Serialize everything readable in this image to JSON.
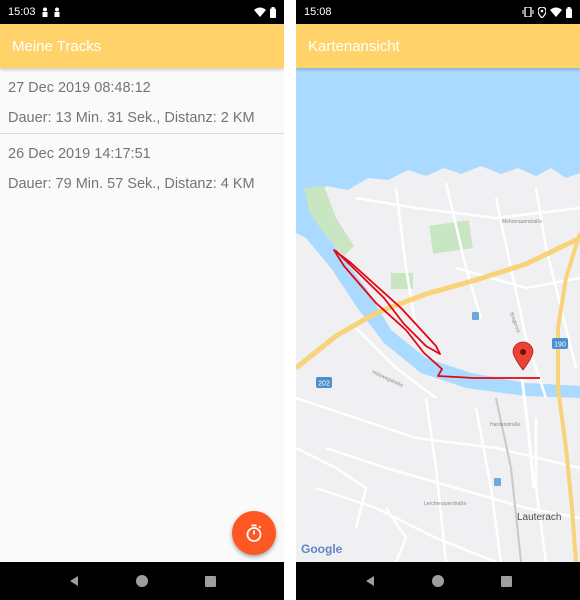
{
  "left_screen": {
    "status_time": "15:03",
    "app_title": "Meine Tracks",
    "tracks": [
      {
        "date": "27 Dec 2019 08:48:12",
        "info": "Dauer: 13 Min. 31 Sek., Distanz: 2 KM"
      },
      {
        "date": "26 Dec 2019 14:17:51",
        "info": "Dauer: 79 Min. 57 Sek., Distanz: 4 KM"
      }
    ],
    "fab_icon": "stopwatch-icon"
  },
  "right_screen": {
    "status_time": "15:08",
    "app_title": "Kartenansicht",
    "map": {
      "labels": {
        "road_202": "202",
        "road_190": "190",
        "place_lauterach": "Lauterach",
        "street_1": "Mehrerauerstraße",
        "street_2": "Holzweg­straße",
        "street_3": "Hardenstraße",
        "street_4": "Lerchenauerstraße",
        "street_5": "Bregenze"
      },
      "google_logo": "Google",
      "marker_icon": "map-pin-icon"
    }
  },
  "colors": {
    "app_bar": "#ffd36a",
    "fab": "#ff5722",
    "water": "#aadaff",
    "track_line": "#e30613",
    "marker": "#ea4335",
    "park": "#c8e6c1"
  }
}
